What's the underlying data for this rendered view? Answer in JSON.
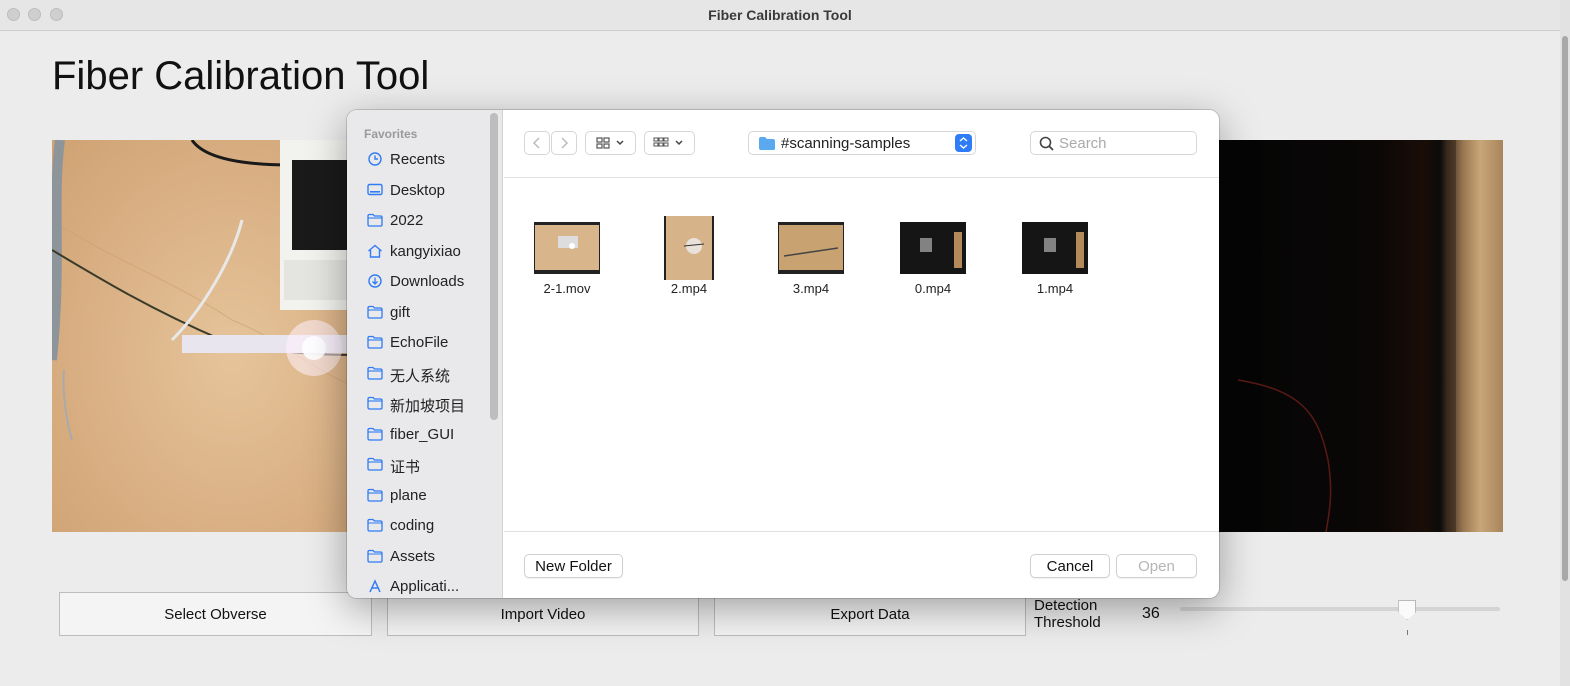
{
  "window": {
    "title": "Fiber Calibration Tool"
  },
  "app": {
    "heading": "Fiber Calibration Tool"
  },
  "controls": {
    "select_obverse": "Select Obverse",
    "import_video": "Import Video",
    "export_data": "Export Data",
    "threshold_label_line1": "Detection",
    "threshold_label_line2": "Threshold",
    "threshold_value": "36",
    "threshold_fraction": 0.71
  },
  "dialog": {
    "sidebar": {
      "section": "Favorites",
      "items": [
        {
          "label": "Recents",
          "icon": "clock-icon"
        },
        {
          "label": "Desktop",
          "icon": "desktop-icon"
        },
        {
          "label": "2022",
          "icon": "folder-icon"
        },
        {
          "label": "kangyixiao",
          "icon": "home-icon"
        },
        {
          "label": "Downloads",
          "icon": "download-icon"
        },
        {
          "label": "gift",
          "icon": "folder-icon"
        },
        {
          "label": "EchoFile",
          "icon": "folder-icon"
        },
        {
          "label": "无人系统",
          "icon": "folder-icon"
        },
        {
          "label": "新加坡项目",
          "icon": "folder-icon"
        },
        {
          "label": "fiber_GUI",
          "icon": "folder-icon"
        },
        {
          "label": "证书",
          "icon": "folder-icon"
        },
        {
          "label": "plane",
          "icon": "folder-icon"
        },
        {
          "label": "coding",
          "icon": "folder-icon"
        },
        {
          "label": "Assets",
          "icon": "folder-icon"
        },
        {
          "label": "Applicati...",
          "icon": "applications-icon"
        }
      ]
    },
    "toolbar": {
      "path": "#scanning-samples",
      "search_placeholder": "Search"
    },
    "files": [
      {
        "name": "2-1.mov"
      },
      {
        "name": "2.mp4"
      },
      {
        "name": "3.mp4"
      },
      {
        "name": "0.mp4"
      },
      {
        "name": "1.mp4"
      }
    ],
    "footer": {
      "new_folder": "New Folder",
      "cancel": "Cancel",
      "open": "Open"
    }
  },
  "colors": {
    "accent": "#2f7cf6",
    "sidebar_icon": "#2f7cf6"
  }
}
